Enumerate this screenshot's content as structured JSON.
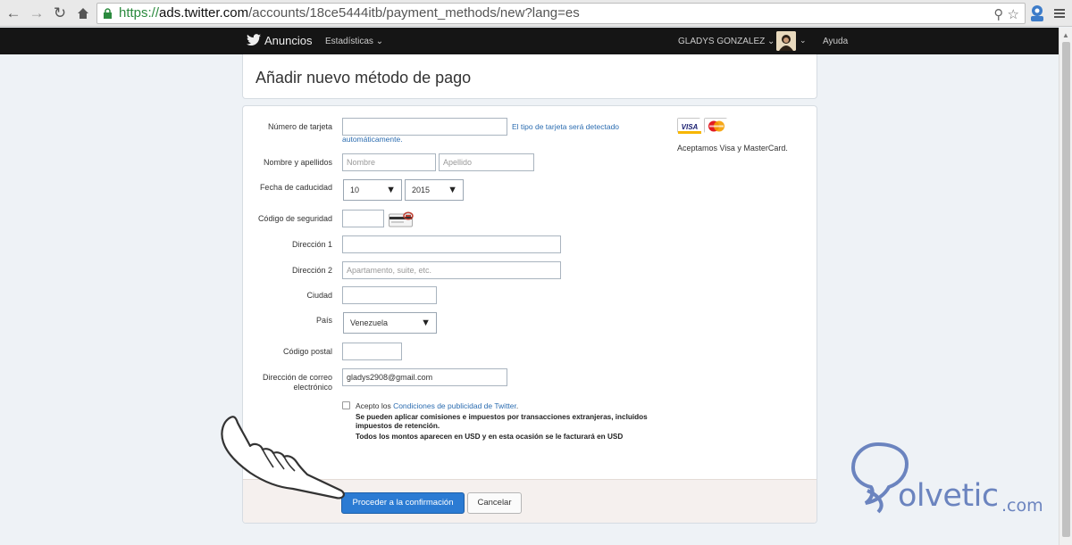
{
  "browser": {
    "url_scheme": "https://",
    "url_host": "ads.twitter.com",
    "url_path": "/accounts/18ce5444itb/payment_methods/new?lang=es"
  },
  "topbar": {
    "brand": "Anuncios",
    "stats_menu": "Estadísticas",
    "user_menu": "GLADYS GONZALEZ",
    "help": "Ayuda"
  },
  "page": {
    "title": "Añadir nuevo método de pago"
  },
  "form": {
    "card_number_label": "Número de tarjeta",
    "card_number_value": "",
    "card_hint_1": "El tipo de tarjeta será detectado",
    "card_hint_2": "automáticamente.",
    "name_label": "Nombre y apellidos",
    "first_name_placeholder": "Nombre",
    "last_name_placeholder": "Apellido",
    "expiry_label": "Fecha de caducidad",
    "expiry_month": "10",
    "expiry_year": "2015",
    "security_label": "Código de seguridad",
    "address1_label": "Dirección 1",
    "address2_label": "Dirección 2",
    "address2_placeholder": "Apartamento, suite, etc.",
    "city_label": "Ciudad",
    "country_label": "País",
    "country_value": "Venezuela",
    "postal_label": "Código postal",
    "email_label_1": "Dirección de correo",
    "email_label_2": "electrónico",
    "email_value": "gladys2908@gmail.com",
    "terms_prefix": "Acepto los ",
    "terms_link": "Condiciones de publicidad de Twitter",
    "terms_suffix": ".",
    "fine_print_1": "Se pueden aplicar comisiones e impuestos por transacciones extranjeras, incluidos impuestos de retención.",
    "fine_print_2": "Todos los montos aparecen en USD y en esta ocasión se le facturará en USD"
  },
  "cards": {
    "visa_label": "VISA",
    "accepted_text": "Aceptamos Visa y MasterCard."
  },
  "actions": {
    "submit_label": "Proceder a la confirmación",
    "cancel_label": "Cancelar"
  },
  "watermark": {
    "text": "olvetic",
    "suffix": ".com"
  },
  "colors": {
    "primary": "#2b7bd3",
    "link": "#2b6cb0",
    "topbar": "#151515"
  }
}
